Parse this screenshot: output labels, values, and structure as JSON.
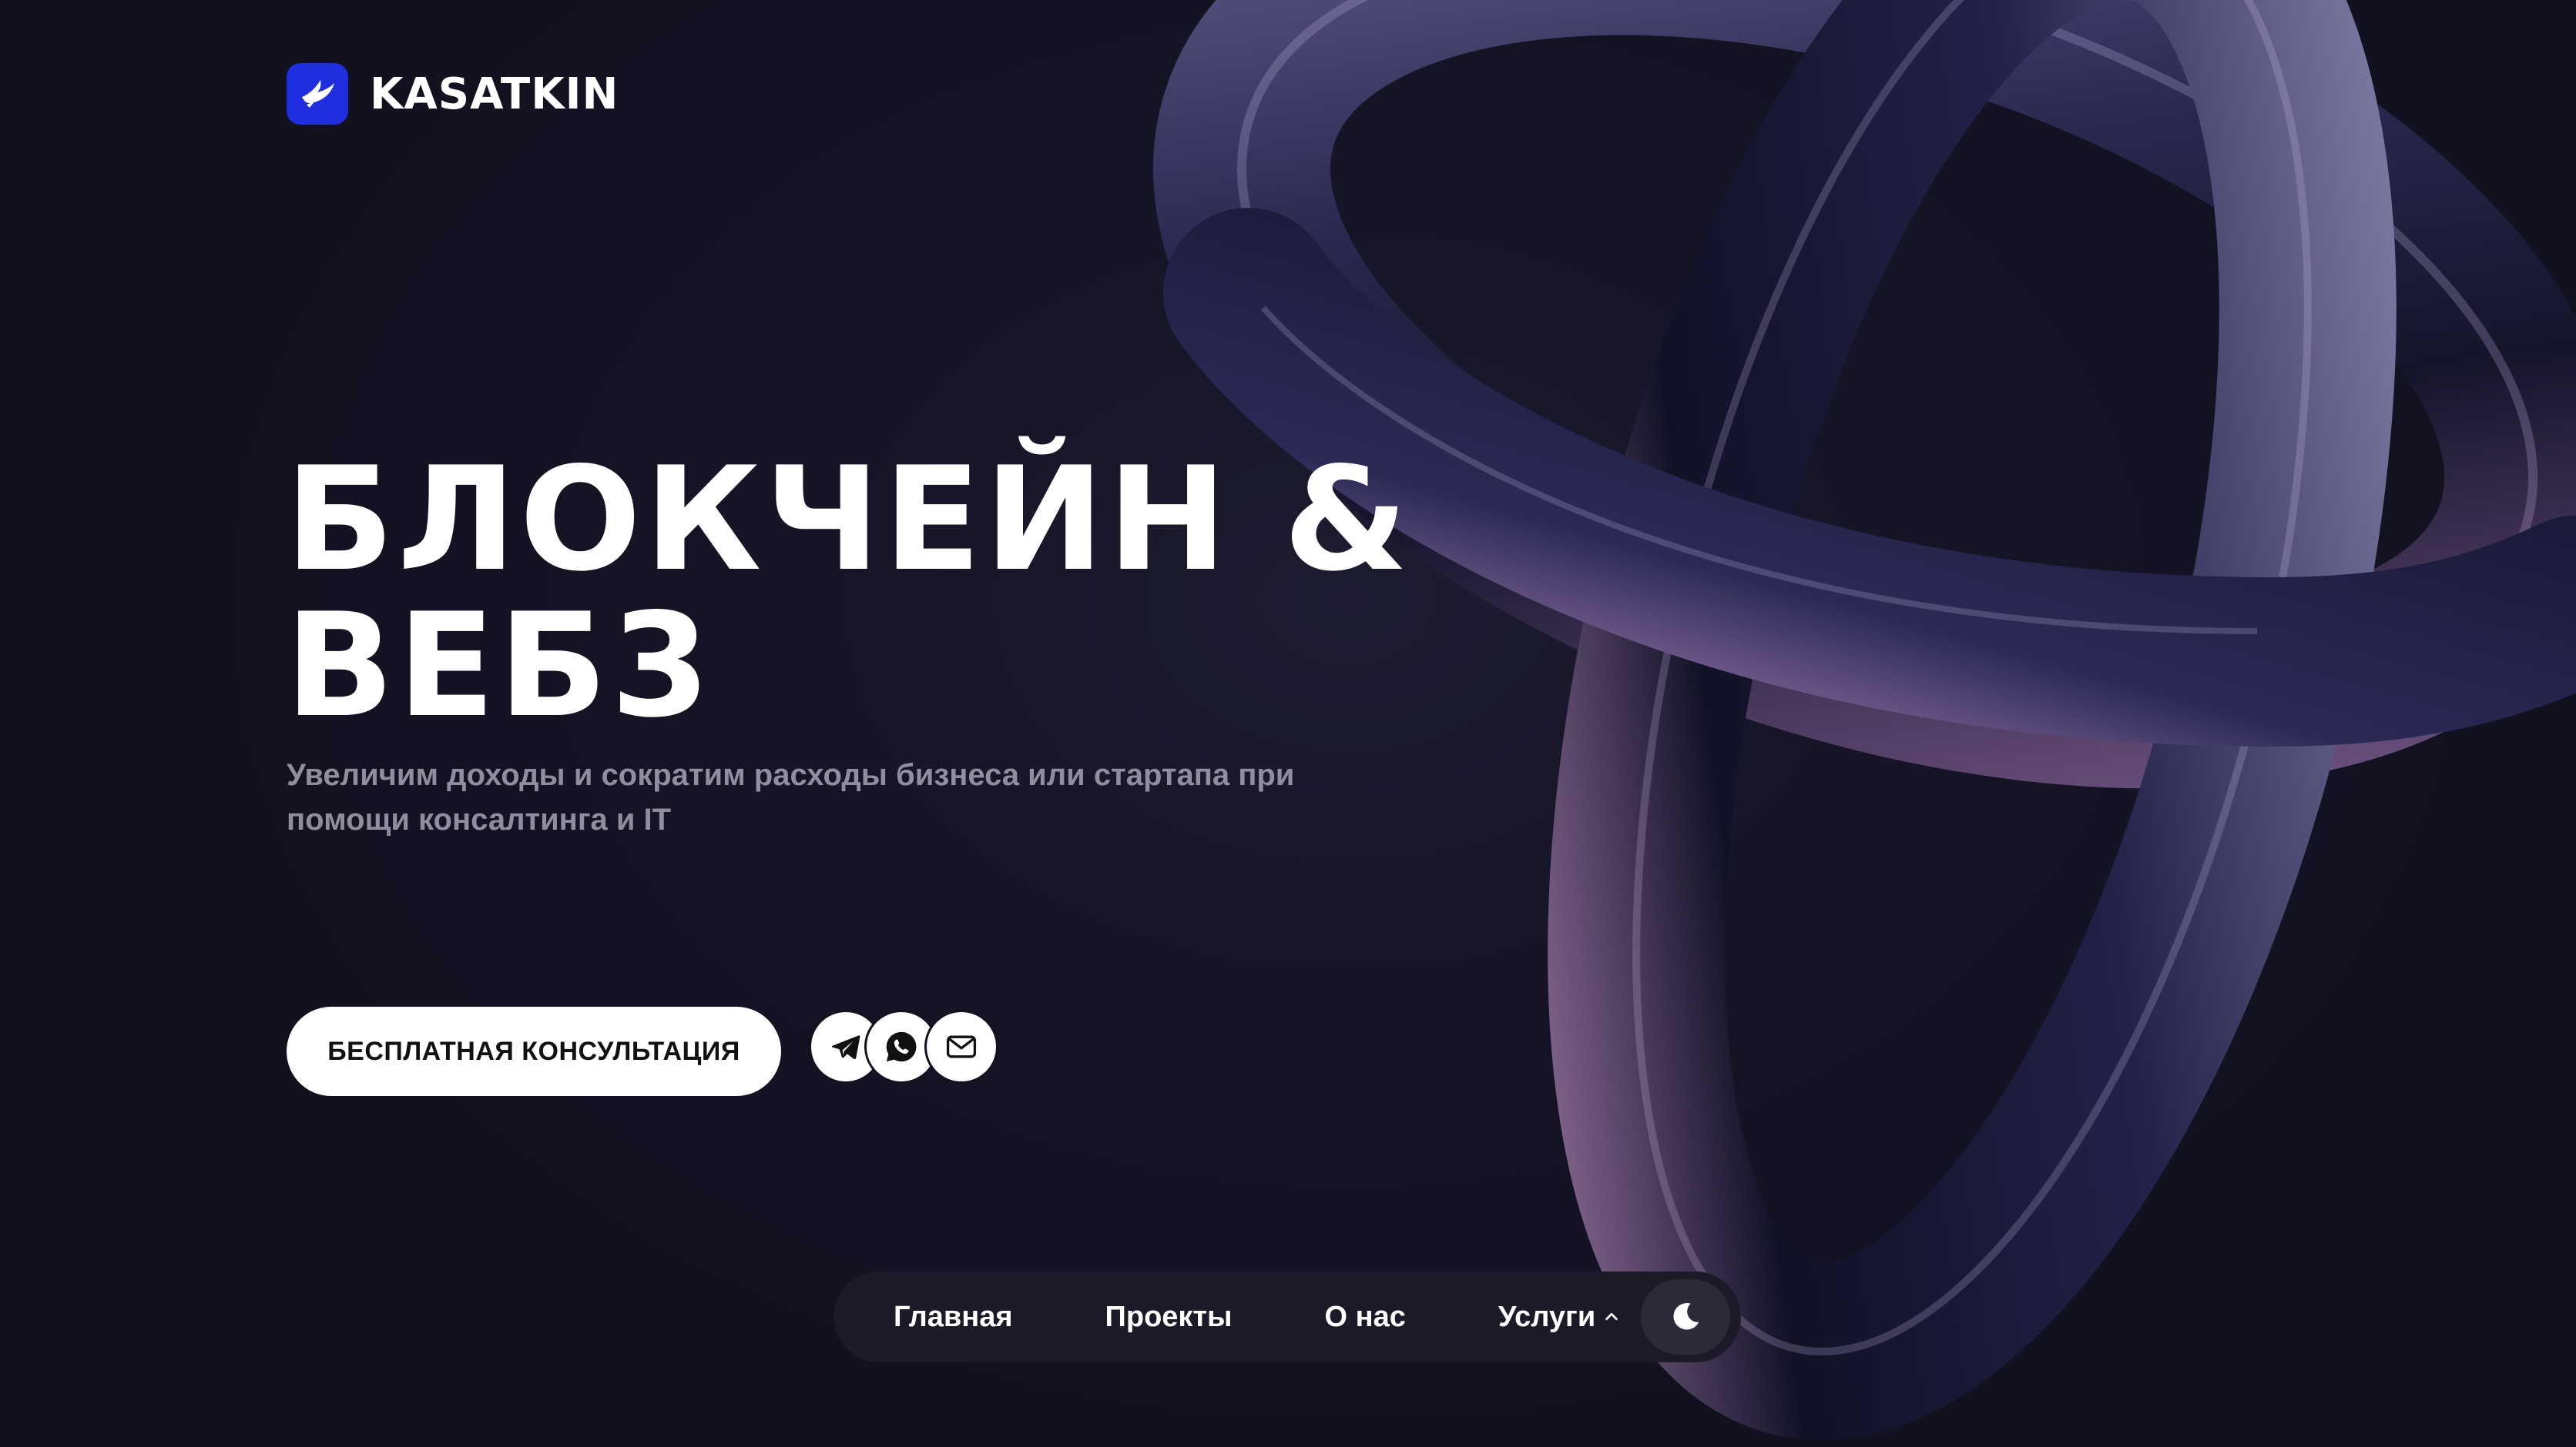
{
  "brand": {
    "name": "KASATKIN",
    "logo_icon": "bird-icon",
    "accent_color": "#1f2fe0"
  },
  "hero": {
    "title_line1": "БЛОКЧЕЙН &",
    "title_line2": "ВЕБ3",
    "subtitle": "Увеличим доходы и сократим расходы бизнеса или стартапа при помощи консалтинга и IT"
  },
  "cta": {
    "label": "БЕСПЛАТНАЯ КОНСУЛЬТАЦИЯ"
  },
  "contacts": [
    {
      "icon": "telegram-icon"
    },
    {
      "icon": "whatsapp-icon"
    },
    {
      "icon": "mail-icon"
    }
  ],
  "nav": {
    "items": [
      {
        "label": "Главная"
      },
      {
        "label": "Проекты"
      },
      {
        "label": "О нас"
      },
      {
        "label": "Услуги",
        "icon": "chevron-up-icon"
      }
    ],
    "theme_toggle_icon": "moon-icon"
  },
  "colors": {
    "background": "#13121f",
    "nav_background": "#1b1a28",
    "subtitle": "#8f8e9c"
  }
}
